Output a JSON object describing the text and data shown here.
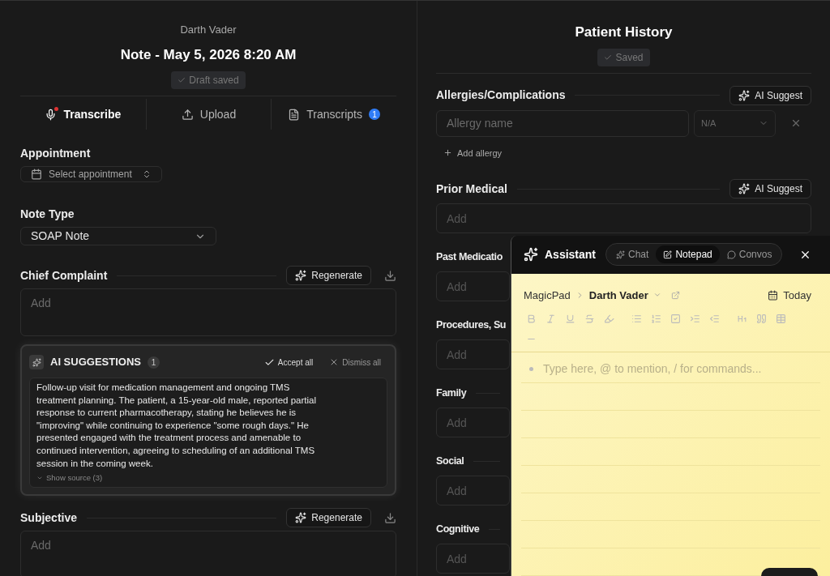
{
  "note": {
    "patient": "Darth Vader",
    "title": "Note - May 5, 2026 8:20 AM",
    "status": "Draft saved",
    "tabs": [
      {
        "kind": "mic",
        "label": "Transcribe",
        "selected": true,
        "recording": true
      },
      {
        "kind": "upload",
        "label": "Upload",
        "selected": false,
        "recording": false
      },
      {
        "kind": "file",
        "label": "Transcripts",
        "selected": false,
        "recording": false,
        "badge": "1"
      }
    ],
    "appointment": {
      "label": "Appointment",
      "placeholder": "Select appointment"
    },
    "note_type": {
      "label": "Note Type",
      "value": "SOAP Note"
    },
    "sections": [
      {
        "label": "Chief Complaint",
        "action": "Regenerate",
        "placeholder": "Add",
        "suggestions": {
          "title": "AI SUGGESTIONS",
          "count": "1",
          "accept": "Accept all",
          "dismiss": "Dismiss all",
          "text": "Follow-up visit for medication management and ongoing TMS treatment planning. The patient, a 15-year-old male, reported partial response to current pharmacotherapy, stating he believes he is \"improving\" while continuing to experience \"some rough days.\" He presented engaged with the treatment process and amenable to continued intervention, agreeing to scheduling of an additional TMS session in the coming week.",
          "source": "Show source (3)"
        }
      },
      {
        "label": "Subjective",
        "action": "Regenerate",
        "placeholder": "Add"
      }
    ]
  },
  "history": {
    "title": "Patient History",
    "status": "Saved",
    "sections": [
      {
        "kind": "allergies",
        "label": "Allergies/Complications",
        "action": "AI Suggest",
        "name_placeholder": "Allergy name",
        "severity": "N/A",
        "add": "Add allergy"
      },
      {
        "kind": "text",
        "label": "Prior Medical",
        "action": "AI Suggest",
        "placeholder": "Add"
      },
      {
        "kind": "text",
        "label": "Past Medicatio",
        "placeholder": "Add"
      },
      {
        "kind": "text",
        "label": "Procedures, Su",
        "placeholder": "Add"
      },
      {
        "kind": "text",
        "label": "Family",
        "placeholder": "Add"
      },
      {
        "kind": "text",
        "label": "Social",
        "placeholder": "Add"
      },
      {
        "kind": "text",
        "label": "Cognitive",
        "placeholder": "Add"
      }
    ]
  },
  "assistant": {
    "title": "Assistant",
    "tabs": [
      {
        "kind": "chat",
        "label": "Chat",
        "selected": false
      },
      {
        "kind": "notepad",
        "label": "Notepad",
        "selected": true
      },
      {
        "kind": "convos",
        "label": "Convos",
        "selected": false
      }
    ],
    "breadcrumb": {
      "root": "MagicPad",
      "current": "Darth Vader"
    },
    "date": "Today",
    "placeholder": "Type here, @ to mention, / for commands..."
  }
}
